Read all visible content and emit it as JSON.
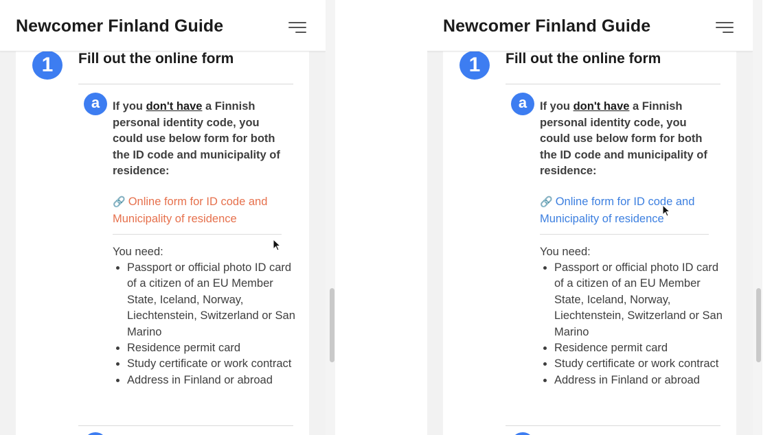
{
  "header": {
    "title": "Newcomer Finland Guide"
  },
  "step": {
    "number": "1",
    "title": "Fill out the online form",
    "sub": {
      "letter": "a",
      "intro_prefix": "If you ",
      "intro_emph": "don't have",
      "intro_suffix": " a Finnish personal identity code, you could use below form for both the ID code and municipality of residence:",
      "link_icon": "link-icon",
      "link_text": "Online form for ID code and Municipality of residence",
      "need_label": "You need:",
      "requirements": [
        "Passport or official photo ID card of a citizen of an EU Member State, Iceland, Norway, Liechtenstein, Switzerland or San Marino",
        "Residence permit card",
        "Study certificate or work contract",
        "Address in Finland or abroad"
      ]
    }
  },
  "colors": {
    "accent": "#3d7df1",
    "link_default": "#e6704c",
    "link_hover": "#3c7fe0"
  },
  "icons": {
    "menu": "hamburger-menu-icon",
    "link": "link-icon",
    "cursor": "mouse-pointer-icon"
  }
}
